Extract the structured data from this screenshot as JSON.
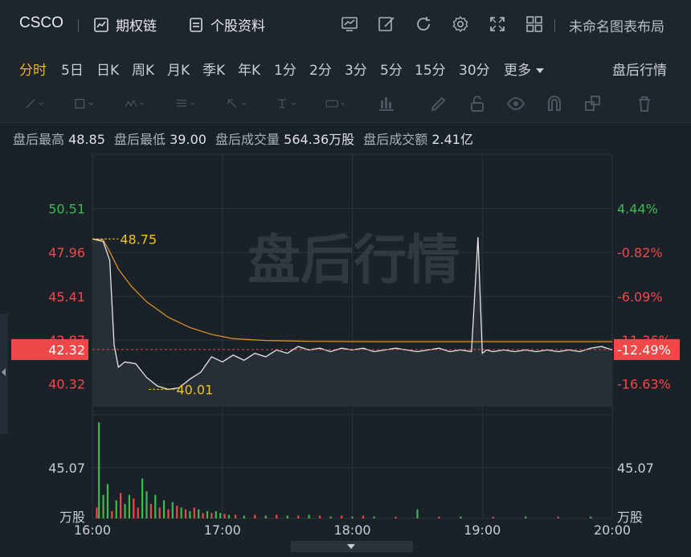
{
  "header": {
    "ticker": "CSCO",
    "options_chain_label": "期权链",
    "stock_info_label": "个股资料",
    "layout_name": "未命名图表布局"
  },
  "periods": [
    "分时",
    "5日",
    "日K",
    "周K",
    "月K",
    "季K",
    "年K",
    "1分",
    "2分",
    "3分",
    "5分",
    "15分",
    "30分",
    "更多"
  ],
  "active_period": "分时",
  "after_hours_tab": "盘后行情",
  "info": {
    "high_label": "盘后最高",
    "high": "48.85",
    "low_label": "盘后最低",
    "low": "39.00",
    "volume_label": "盘后成交量",
    "volume": "564.36万股",
    "amount_label": "盘后成交额",
    "amount": "2.41亿"
  },
  "colors": {
    "up": "#3fb950",
    "down": "#f04848",
    "price_line": "#e6e6e6",
    "avg_line": "#e0962a",
    "annotation": "#f0c419",
    "grid": "#2b323b"
  },
  "chart_data": {
    "type": "line",
    "watermark": "盘后行情",
    "x_ticks": [
      "16:00",
      "17:00",
      "18:00",
      "19:00",
      "20:00"
    ],
    "price_ticks_left": [
      "50.51",
      "47.96",
      "45.41",
      "42.87",
      "40.32"
    ],
    "price_ticks_right": [
      "4.44%",
      "-0.82%",
      "-6.09%",
      "-11.36%",
      "-16.63%"
    ],
    "current_price": "42.32",
    "current_change": "-12.49%",
    "ylim": [
      39.0,
      51.8
    ],
    "volume_ticks_left": [
      "45.07",
      "万股"
    ],
    "volume_ticks_right": [
      "45.07",
      "万股"
    ],
    "annotations": [
      {
        "text": "48.75",
        "value": 48.75
      },
      {
        "text": "40.01",
        "value": 40.01
      }
    ],
    "price_series": {
      "x_minutes": [
        0,
        5,
        8,
        10,
        12,
        15,
        20,
        25,
        30,
        35,
        40,
        45,
        50,
        55,
        60,
        65,
        70,
        75,
        80,
        85,
        90,
        95,
        100,
        105,
        110,
        115,
        120,
        125,
        130,
        135,
        140,
        145,
        150,
        155,
        160,
        165,
        170,
        175,
        178,
        180,
        182,
        185,
        190,
        195,
        200,
        205,
        210,
        215,
        220,
        225,
        230,
        235,
        240
      ],
      "values": [
        48.75,
        48.6,
        47.5,
        42.6,
        41.3,
        41.6,
        41.5,
        40.7,
        40.2,
        40.01,
        40.1,
        40.6,
        41.0,
        41.9,
        41.6,
        42.0,
        41.7,
        42.1,
        41.9,
        42.3,
        42.1,
        42.5,
        42.3,
        42.4,
        42.2,
        42.4,
        42.3,
        42.4,
        42.2,
        42.3,
        42.4,
        42.3,
        42.2,
        42.3,
        42.4,
        42.2,
        42.3,
        42.2,
        48.85,
        42.1,
        42.3,
        42.2,
        42.3,
        42.2,
        42.3,
        42.2,
        42.3,
        42.2,
        42.3,
        42.2,
        42.4,
        42.5,
        42.3
      ]
    },
    "avg_series": {
      "x_minutes": [
        0,
        5,
        8,
        12,
        18,
        25,
        35,
        45,
        55,
        65,
        80,
        100,
        130,
        160,
        200,
        240
      ],
      "values": [
        48.75,
        48.7,
        48.0,
        47.0,
        46.0,
        45.1,
        44.2,
        43.6,
        43.2,
        42.95,
        42.85,
        42.8,
        42.78,
        42.78,
        42.78,
        42.78
      ]
    },
    "volume_series": {
      "x_minutes": [
        2,
        3,
        5,
        7,
        9,
        11,
        13,
        15,
        17,
        19,
        21,
        23,
        25,
        27,
        29,
        31,
        33,
        35,
        37,
        39,
        41,
        43,
        45,
        47,
        49,
        51,
        53,
        55,
        57,
        59,
        61,
        63,
        66,
        70,
        75,
        80,
        85,
        90,
        95,
        100,
        105,
        110,
        115,
        120,
        125,
        130,
        140,
        150,
        160,
        170,
        185,
        200,
        215,
        230
      ],
      "values": [
        12,
        106,
        26,
        38,
        8,
        20,
        28,
        16,
        26,
        22,
        12,
        44,
        30,
        16,
        26,
        12,
        20,
        10,
        18,
        14,
        12,
        10,
        8,
        12,
        10,
        6,
        8,
        6,
        8,
        6,
        5,
        4,
        4,
        3,
        4,
        3,
        4,
        3,
        3,
        4,
        3,
        2,
        3,
        2,
        3,
        2,
        2,
        10,
        2,
        2,
        2,
        2,
        2,
        2
      ],
      "up": [
        false,
        true,
        true,
        true,
        false,
        true,
        false,
        true,
        true,
        false,
        false,
        true,
        true,
        false,
        true,
        false,
        true,
        false,
        true,
        false,
        true,
        false,
        true,
        false,
        true,
        false,
        true,
        false,
        true,
        true,
        false,
        true,
        false,
        true,
        false,
        true,
        false,
        true,
        false,
        true,
        false,
        true,
        false,
        true,
        false,
        true,
        false,
        true,
        false,
        true,
        false,
        true,
        false,
        true
      ]
    }
  }
}
